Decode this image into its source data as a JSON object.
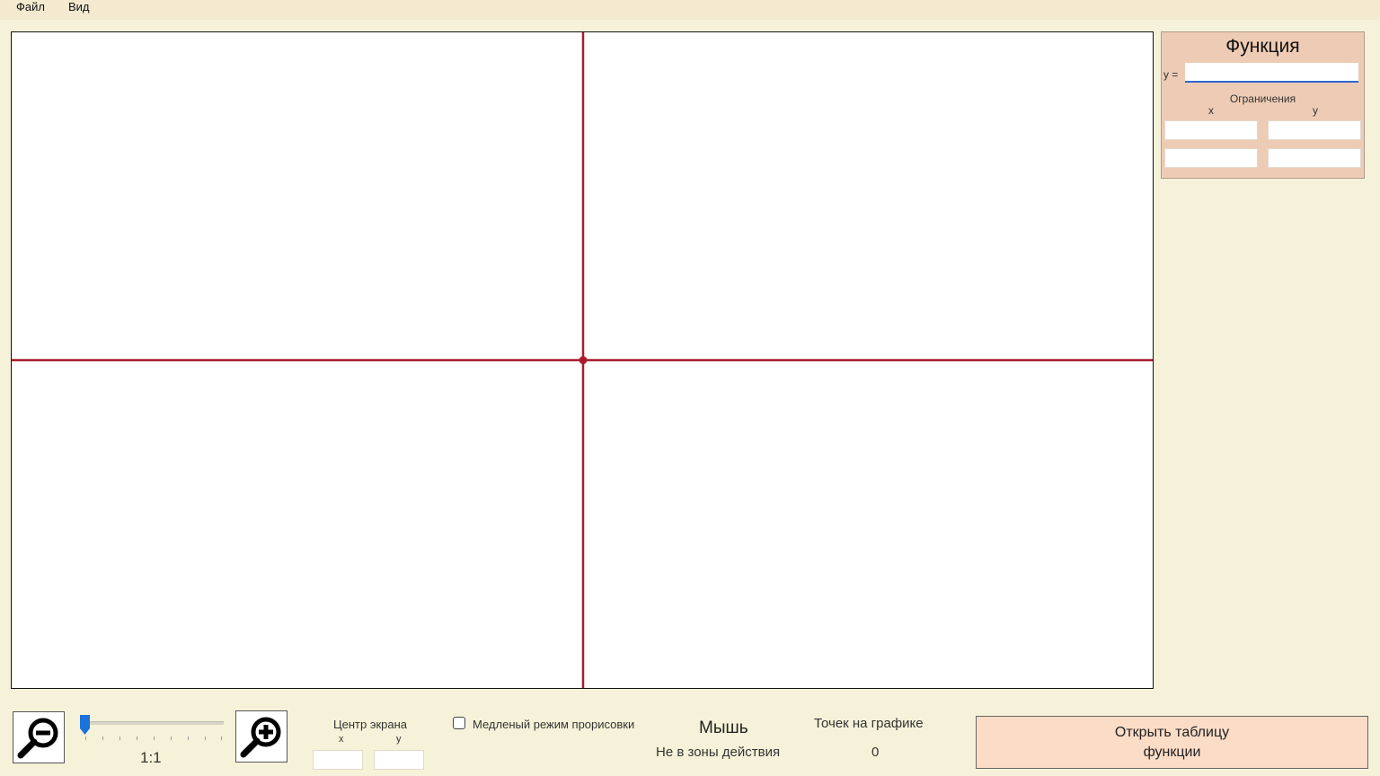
{
  "menu": {
    "items": [
      "Файл",
      "Вид"
    ]
  },
  "colors": {
    "background": "#f6f2d9",
    "panel": "#eecbb4",
    "axis": "#a81c2c",
    "button": "#fbdcc7",
    "focus": "#2a6ad1"
  },
  "function_panel": {
    "title": "Функция",
    "y_label": "y =",
    "function_value": "",
    "limits_label": "Ограничения",
    "x_label": "x",
    "y_col_label": "y",
    "x_min": "",
    "x_max": "",
    "y_min": "",
    "y_max": ""
  },
  "zoom": {
    "scale_label": "1:1",
    "zoom_out_icon": "zoom-out-magnifier-icon",
    "zoom_in_icon": "zoom-in-magnifier-icon",
    "slider_level": 0
  },
  "center": {
    "label": "Центр экрана",
    "x_label": "x",
    "y_label": "y",
    "x_value": "",
    "y_value": ""
  },
  "slow_mode": {
    "label": "Медленый режим прорисовки",
    "checked": false
  },
  "mouse": {
    "title": "Мышь",
    "status": "Не в зоны действия"
  },
  "points": {
    "title": "Точек на графике",
    "count": "0"
  },
  "open_table": {
    "line1": "Открыть таблицу",
    "line2": "функции"
  }
}
